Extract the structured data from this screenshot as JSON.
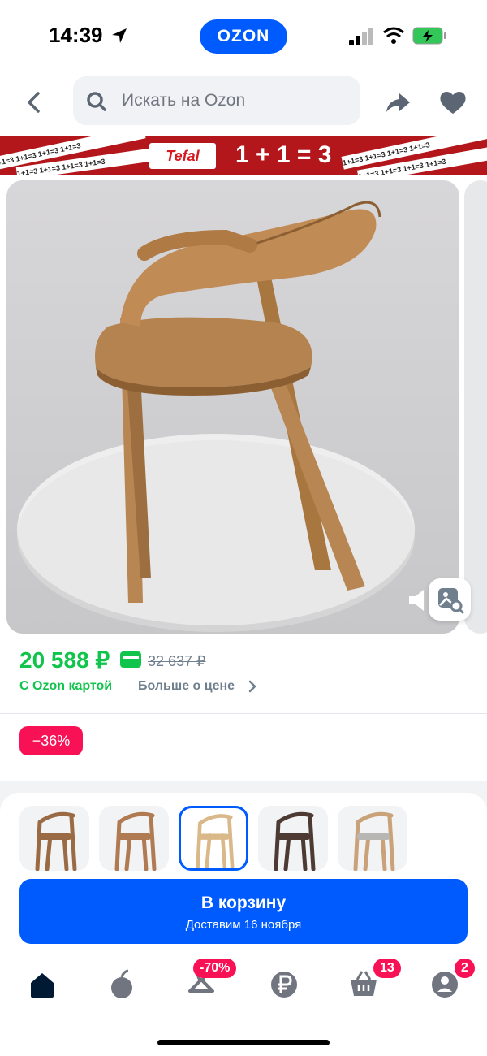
{
  "status_bar": {
    "time": "14:39",
    "app_logo": "OZON"
  },
  "header": {
    "search_placeholder": "Искать на Ozon"
  },
  "promo": {
    "brand": "Tefal",
    "slogan": "1 + 1 = 3",
    "stripe_text": "1+1=3  1+1=3  1+1=3  1+1=3"
  },
  "product": {
    "price": "20 588 ₽",
    "old_price": "32 637 ₽",
    "card_label": "С Ozon картой",
    "more_price": "Больше о цене",
    "discount": "−36%"
  },
  "variants": [
    {
      "color": "#9a6a45",
      "selected": false
    },
    {
      "color": "#b07a52",
      "selected": false
    },
    {
      "color": "#d9b98a",
      "selected": true
    },
    {
      "color": "#4d3a33",
      "selected": false
    },
    {
      "color": "#c9a27a",
      "selected": false
    }
  ],
  "cart": {
    "title": "В корзину",
    "subtitle": "Доставим 16 ноября"
  },
  "nav": {
    "items": [
      {
        "icon": "home-icon",
        "badge": ""
      },
      {
        "icon": "fresh-icon",
        "badge": ""
      },
      {
        "icon": "sale-icon",
        "badge": "-70%"
      },
      {
        "icon": "ruble-icon",
        "badge": ""
      },
      {
        "icon": "cart-icon",
        "badge": "13"
      },
      {
        "icon": "profile-icon",
        "badge": "2"
      }
    ]
  },
  "colors": {
    "brand": "#005bff",
    "price": "#10c44c",
    "badge": "#f91155"
  }
}
